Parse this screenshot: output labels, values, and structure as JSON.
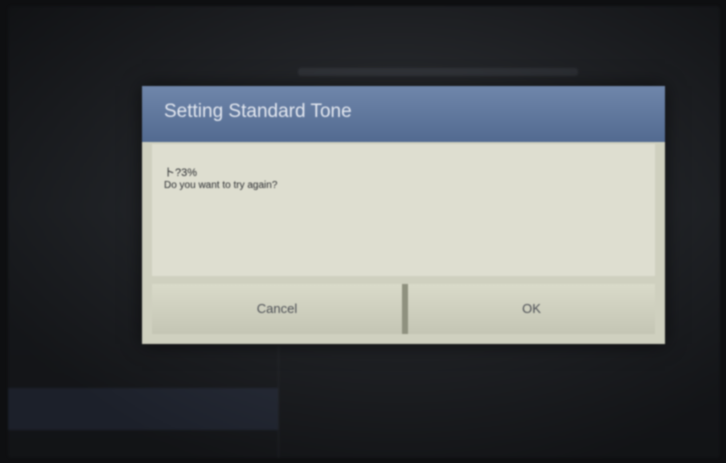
{
  "background": {
    "title": "",
    "list_items": [
      {
        "label": ""
      },
      {
        "label": ""
      },
      {
        "label": ""
      },
      {
        "label": ""
      },
      {
        "label": ""
      },
      {
        "label": ""
      },
      {
        "label": ""
      },
      {
        "label": ""
      }
    ]
  },
  "dialog": {
    "title": "Setting Standard Tone",
    "message_code": "ト?3%",
    "message": "Do you want to try again?",
    "cancel_label": "Cancel",
    "ok_label": "OK"
  },
  "colors": {
    "dialog_header": "#5f789d",
    "dialog_body": "#deded0",
    "button_face": "#cecfbe"
  }
}
